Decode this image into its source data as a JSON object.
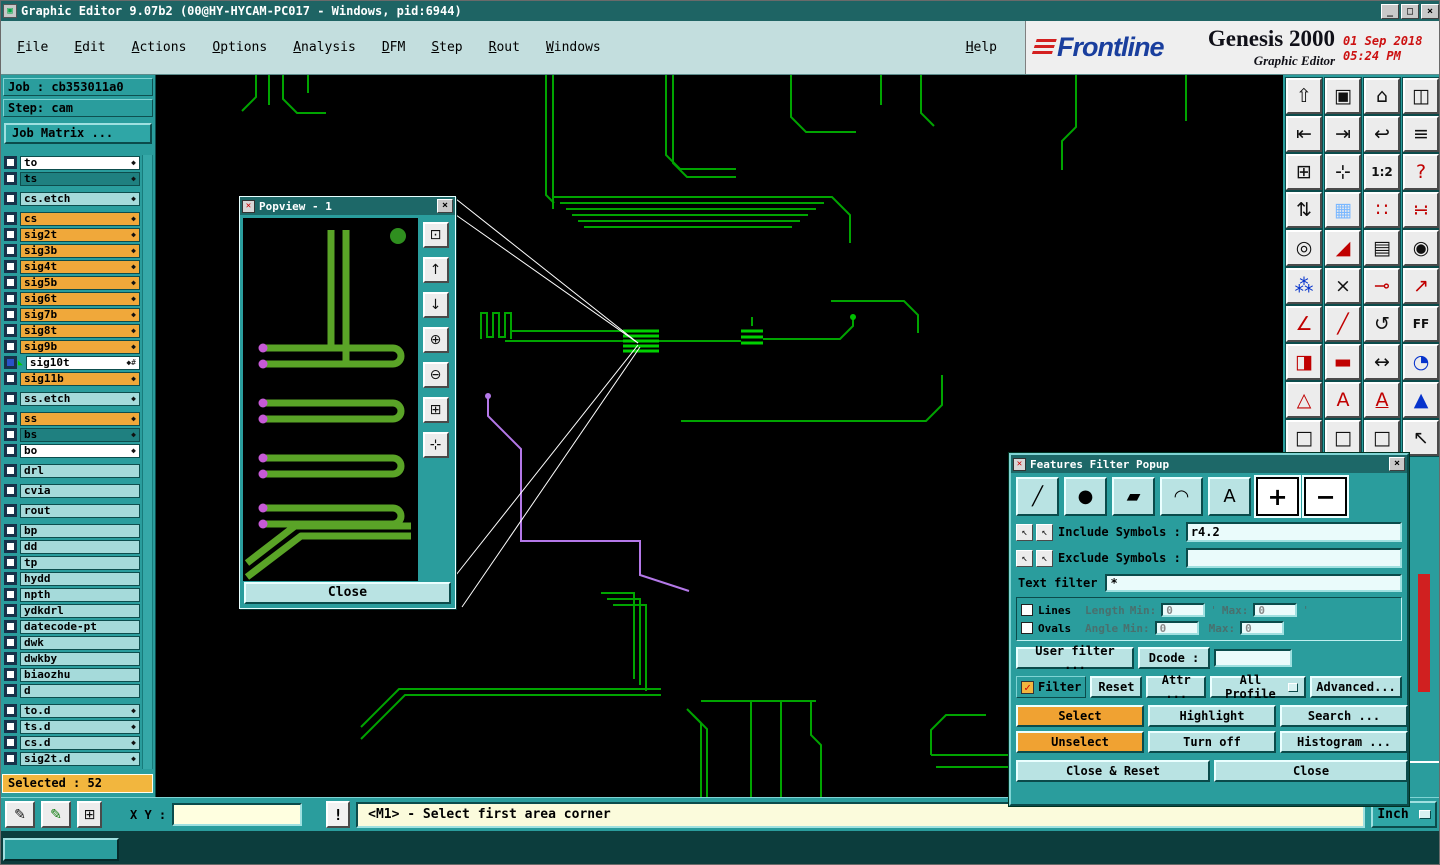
{
  "window": {
    "title": "Graphic Editor 9.07b2 (00@HY-HYCAM-PC017 - Windows, pid:6944)",
    "buttons": {
      "minimize": "_",
      "maximize": "□",
      "close": "×"
    },
    "app_icon": "▣"
  },
  "menubar": {
    "items": [
      "File",
      "Edit",
      "Actions",
      "Options",
      "Analysis",
      "DFM",
      "Step",
      "Rout",
      "Windows"
    ],
    "help": "Help"
  },
  "branding": {
    "logo": "Frontline",
    "product": "Genesis 2000",
    "date": "01 Sep 2018",
    "time": "05:24 PM",
    "subtitle": "Graphic Editor"
  },
  "job_panel": {
    "job": "Job : cb353011a0",
    "step": "Step: cam",
    "matrix_button": "Job Matrix ...",
    "selected": "Selected : 52"
  },
  "layers": [
    {
      "name": "to",
      "color": "white",
      "marker": true
    },
    {
      "name": "ts",
      "color": "sel",
      "marker": true
    },
    {
      "name": "cs.etch",
      "color": "cyan",
      "marker": true,
      "gap": true
    },
    {
      "name": "cs",
      "color": "orange",
      "marker": true,
      "gap": true
    },
    {
      "name": "sig2t",
      "color": "orange",
      "marker": true
    },
    {
      "name": "sig3b",
      "color": "orange",
      "marker": true
    },
    {
      "name": "sig4t",
      "color": "orange",
      "marker": true
    },
    {
      "name": "sig5b",
      "color": "orange",
      "marker": true
    },
    {
      "name": "sig6t",
      "color": "orange",
      "marker": true
    },
    {
      "name": "sig7b",
      "color": "orange",
      "marker": true
    },
    {
      "name": "sig8t",
      "color": "orange",
      "marker": true
    },
    {
      "name": "sig9b",
      "color": "orange",
      "marker": true
    },
    {
      "name": "sig10t",
      "color": "white",
      "marker": true,
      "active": true
    },
    {
      "name": "sig11b",
      "color": "orange",
      "marker": true
    },
    {
      "name": "ss.etch",
      "color": "cyan",
      "marker": true,
      "gap": true
    },
    {
      "name": "ss",
      "color": "orange",
      "marker": true,
      "gap": true
    },
    {
      "name": "bs",
      "color": "sel",
      "marker": true
    },
    {
      "name": "bo",
      "color": "white",
      "marker": true
    },
    {
      "name": "drl",
      "color": "cyan",
      "marker": false,
      "gap": true
    },
    {
      "name": "cvia",
      "color": "cyan",
      "marker": false,
      "gap": true
    },
    {
      "name": "rout",
      "color": "cyan",
      "marker": false,
      "gap": true
    },
    {
      "name": "bp",
      "color": "cyan",
      "marker": false,
      "gap": true
    },
    {
      "name": "dd",
      "color": "cyan",
      "marker": false
    },
    {
      "name": "tp",
      "color": "cyan",
      "marker": false
    },
    {
      "name": "hydd",
      "color": "cyan",
      "marker": false
    },
    {
      "name": "npth",
      "color": "cyan",
      "marker": false
    },
    {
      "name": "ydkdrl",
      "color": "cyan",
      "marker": false
    },
    {
      "name": "datecode-pt",
      "color": "cyan",
      "marker": false
    },
    {
      "name": "dwk",
      "color": "cyan",
      "marker": false
    },
    {
      "name": "dwkby",
      "color": "cyan",
      "marker": false
    },
    {
      "name": "biaozhu",
      "color": "cyan",
      "marker": false
    },
    {
      "name": "d",
      "color": "cyan",
      "marker": false
    },
    {
      "name": "to.d",
      "color": "cyan",
      "marker": true,
      "gap": true
    },
    {
      "name": "ts.d",
      "color": "cyan",
      "marker": true
    },
    {
      "name": "cs.d",
      "color": "cyan",
      "marker": true
    },
    {
      "name": "sig2t.d",
      "color": "cyan",
      "marker": true
    }
  ],
  "popview": {
    "icon": "✕",
    "title": "Popview - 1",
    "close_icon": "×",
    "close_button": "Close",
    "tools": [
      {
        "n": "zoom-box-icon",
        "g": "⊡"
      },
      {
        "n": "pan-up-icon",
        "g": "↑"
      },
      {
        "n": "pan-down-icon",
        "g": "↓"
      },
      {
        "n": "zoom-in-icon",
        "g": "⊕"
      },
      {
        "n": "zoom-out-icon",
        "g": "⊖"
      },
      {
        "n": "zoom-fit-icon",
        "g": "⊞"
      },
      {
        "n": "pan-free-icon",
        "g": "⊹"
      }
    ]
  },
  "right_toolbar": {
    "buttons": [
      {
        "n": "paste-view-icon",
        "g": "⇧",
        "c": "k"
      },
      {
        "n": "display-icon",
        "g": "▣",
        "c": "k"
      },
      {
        "n": "home-view-icon",
        "g": "⌂",
        "c": "k"
      },
      {
        "n": "tile-windows-icon",
        "g": "◫",
        "c": "k"
      },
      {
        "n": "shift-left-icon",
        "g": "⇤",
        "c": "k"
      },
      {
        "n": "shift-right-icon",
        "g": "⇥",
        "c": "k"
      },
      {
        "n": "previous-view-icon",
        "g": "↩",
        "c": "k"
      },
      {
        "n": "layers-list-icon",
        "g": "≡",
        "c": "k"
      },
      {
        "n": "zoom-window-icon",
        "g": "⊞",
        "c": "k"
      },
      {
        "n": "pan-cross-icon",
        "g": "⊹",
        "c": "k"
      },
      {
        "n": "zoom-scale-icon",
        "g": "1:2",
        "c": "k"
      },
      {
        "n": "help-icon",
        "g": "?",
        "c": "r"
      },
      {
        "n": "swap-layers-icon",
        "g": "⇅",
        "c": "k"
      },
      {
        "n": "grid-icon",
        "g": "▦",
        "c": "lb"
      },
      {
        "n": "dot-grid-icon",
        "g": "∷",
        "c": "r"
      },
      {
        "n": "snap-grid-icon",
        "g": "∺",
        "c": "r"
      },
      {
        "n": "select-feature-icon",
        "g": "◎",
        "c": "k"
      },
      {
        "n": "corner-select-icon",
        "g": "◢",
        "c": "r"
      },
      {
        "n": "measure-ruler-icon",
        "g": "▤",
        "c": "k"
      },
      {
        "n": "pad-mode-icon",
        "g": "◉",
        "c": "k"
      },
      {
        "n": "net-points-icon",
        "g": "⁂",
        "c": "b"
      },
      {
        "n": "delete-icon",
        "g": "×",
        "c": "k"
      },
      {
        "n": "node-icon",
        "g": "⊸",
        "c": "r"
      },
      {
        "n": "vector-icon",
        "g": "↗",
        "c": "r"
      },
      {
        "n": "angle-icon",
        "g": "∠",
        "c": "r"
      },
      {
        "n": "diagonal-line-icon",
        "g": "╱",
        "c": "r"
      },
      {
        "n": "rotate-icon",
        "g": "↺",
        "c": "k"
      },
      {
        "n": "ff-icon",
        "g": "FF",
        "c": "k"
      },
      {
        "n": "half-square-icon",
        "g": "◨",
        "c": "r"
      },
      {
        "n": "dash-icon",
        "g": "▬",
        "c": "r"
      },
      {
        "n": "width-icon",
        "g": "↔",
        "c": "k"
      },
      {
        "n": "quarter-circle-icon",
        "g": "◔",
        "c": "b"
      },
      {
        "n": "triangle-outline-icon",
        "g": "△",
        "c": "r"
      },
      {
        "n": "text-a-icon",
        "g": "A",
        "c": "r"
      },
      {
        "n": "text-underline-icon",
        "g": "A",
        "c": "r",
        "u": true
      },
      {
        "n": "triangle-solid-icon",
        "g": "▲",
        "c": "b"
      },
      {
        "n": "blank-icon",
        "g": "□",
        "c": "k"
      },
      {
        "n": "blank-icon",
        "g": "□",
        "c": "k"
      },
      {
        "n": "blank-icon",
        "g": "□",
        "c": "k"
      },
      {
        "n": "pointer-icon",
        "g": "↖",
        "c": "k"
      }
    ]
  },
  "filter_popup": {
    "icon": "✕",
    "title": "Features Filter Popup",
    "close_icon": "×",
    "feature_buttons": [
      {
        "n": "lines-filter-icon",
        "g": "╱"
      },
      {
        "n": "pads-filter-icon",
        "g": "●"
      },
      {
        "n": "surfaces-filter-icon",
        "g": "▰"
      },
      {
        "n": "arcs-filter-icon",
        "g": "◠"
      },
      {
        "n": "text-filter-icon",
        "g": "A"
      },
      {
        "n": "positive-filter-icon",
        "g": "+",
        "active": true
      },
      {
        "n": "negative-filter-icon",
        "g": "−",
        "active": true
      }
    ],
    "pick_icon": "↖",
    "include_label": "Include Symbols :",
    "include_value": "r4.2",
    "exclude_label": "Exclude Symbols :",
    "exclude_value": "",
    "text_filter_label": "Text filter",
    "text_filter_value": "*",
    "lines_label": "Lines",
    "ovals_label": "Ovals",
    "length_label": "Length",
    "angle_label": "Angle",
    "min_label": "Min:",
    "max_label": "Max:",
    "length_min": "0",
    "length_max": "0",
    "angle_min": "0",
    "angle_max": "0",
    "unit_mark": "'",
    "user_filter_button": "User filter ...",
    "dcode_label": "Dcode :",
    "dcode_value": "",
    "filter_check_icon": "✓",
    "filter_check": "Filter",
    "reset_button": "Reset",
    "attr_button": "Attr ...",
    "profile_button": "All Profile",
    "profile_menu_icon": "▭",
    "advanced_button": "Advanced...",
    "select_button": "Select",
    "highlight_button": "Highlight",
    "search_button": "Search ...",
    "unselect_button": "Unselect",
    "turnoff_button": "Turn off",
    "histogram_button": "Histogram ...",
    "close_reset_button": "Close & Reset",
    "close_button": "Close"
  },
  "statusbar": {
    "snap_icon": "✎",
    "edit_icon": "✎",
    "grid_icon": "⊞",
    "xy_label": "X Y :",
    "xy_value": "",
    "alert": "!",
    "message": "<M1> - Select first area corner",
    "units": "Inch",
    "units_icon": "▭"
  }
}
